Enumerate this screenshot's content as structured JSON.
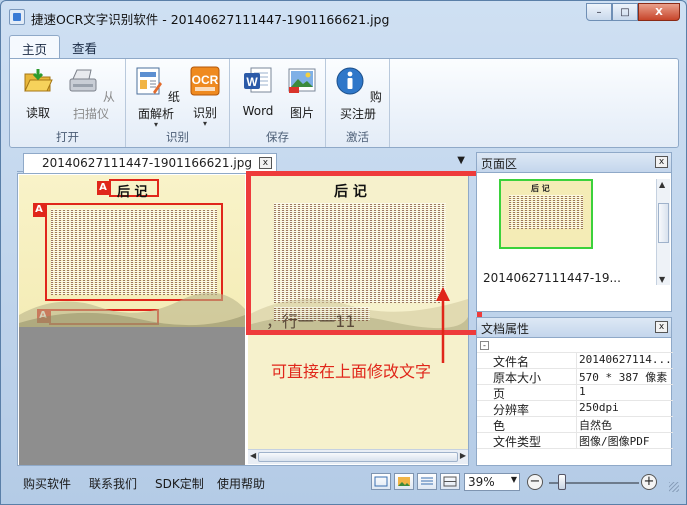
{
  "window": {
    "title": "捷速OCR文字识别软件 - 20140627111447-1901166621.jpg",
    "controls": {
      "minimize": "–",
      "maximize": "□",
      "close": "X"
    }
  },
  "ribbon": {
    "tabs": [
      {
        "label": "主页",
        "active": true
      },
      {
        "label": "查看",
        "active": false
      }
    ],
    "groups": {
      "open": {
        "label": "打开",
        "buttons": [
          {
            "label": "读取",
            "icon": "folder-open-icon"
          },
          {
            "label": "从扫描仪",
            "icon": "scanner-icon",
            "disabled": true
          }
        ]
      },
      "recognize": {
        "label": "识别",
        "buttons": [
          {
            "label": "纸面解析",
            "icon": "layout-analysis-icon"
          },
          {
            "label": "识别",
            "icon": "ocr-icon"
          }
        ]
      },
      "save": {
        "label": "保存",
        "buttons": [
          {
            "label": "Word",
            "icon": "word-icon"
          },
          {
            "label": "图片",
            "icon": "image-icon"
          }
        ]
      },
      "activate": {
        "label": "激活",
        "buttons": [
          {
            "label": "购买注册",
            "icon": "info-icon"
          }
        ]
      }
    }
  },
  "document": {
    "tab_label": "20140627111447-1901166621.jpg",
    "tab_close": "x",
    "tab_dropdown": "▼",
    "page_heading": "后 记",
    "recognized_heading": "后 记",
    "recognized_line": "，行一 一11",
    "region_marker": "A",
    "hint": "可直接在上面修改文字"
  },
  "page_panel": {
    "title": "页面区",
    "close": "x",
    "thumbnail_caption": "20140627111447-19...",
    "thumbnail_heading": "后 记"
  },
  "props_panel": {
    "title": "文档属性",
    "close": "x",
    "collapse": "-",
    "rows": [
      {
        "key": "文件名",
        "value": "20140627114..."
      },
      {
        "key": "原本大小",
        "value": "570 * 387 像素"
      },
      {
        "key": "页",
        "value": "1"
      },
      {
        "key": "分辨率",
        "value": "250dpi"
      },
      {
        "key": "色",
        "value": "自然色"
      },
      {
        "key": "文件类型",
        "value": "图像/图像PDF"
      }
    ]
  },
  "statusbar": {
    "links": [
      "购买软件",
      "联系我们",
      "SDK定制",
      "使用帮助"
    ],
    "zoom": "39%",
    "zoom_out": "−",
    "zoom_in": "+"
  },
  "colors": {
    "accent_red": "#e0261a",
    "selection_green": "#3bd13b",
    "chrome_blue": "#b9d1ea"
  }
}
